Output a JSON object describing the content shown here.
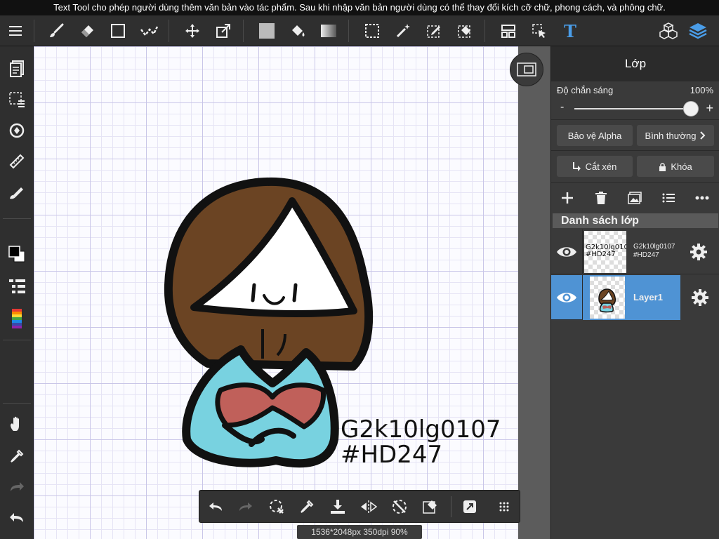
{
  "banner": {
    "text": "Text Tool cho phép người dùng thêm văn bản vào tác phẩm. Sau khi nhập văn bản người dùng có thể thay đổi kích cỡ chữ, phong cách, và phông chữ."
  },
  "toolbar": {
    "icons": [
      "menu-icon",
      "brush-icon",
      "eraser-icon",
      "rectangle-icon",
      "smudge-icon",
      "move-icon",
      "transform-icon",
      "fill-color-icon",
      "bucket-icon",
      "gradient-icon",
      "select-rect-icon",
      "magic-wand-icon",
      "select-pen-icon",
      "select-eraser-icon",
      "layout-icon",
      "select-move-icon",
      "text-tool-icon",
      "3d-model-icon",
      "layers-icon"
    ],
    "text_tool_glyph": "T"
  },
  "canvas": {
    "text_line1": "G2k10lg0107",
    "text_line2": "#HD247",
    "colors": {
      "hair": "#6b4423",
      "shirt": "#78d2e0",
      "bow": "#c0605a",
      "outline": "#111111"
    }
  },
  "status": {
    "canvas_info": "1536*2048px 350dpi 90%"
  },
  "panel": {
    "title": "Lớp",
    "opacity_label": "Độ chắn sáng",
    "opacity_value": "100%",
    "opacity_fraction": 1.0,
    "minus": "-",
    "plus": "+",
    "alpha_protect": "Bảo vệ Alpha",
    "blend_mode": "Bình thường",
    "clip": "Cắt xén",
    "lock": "Khóa",
    "list_header": "Danh sách lớp",
    "layers": [
      {
        "thumb_text": "G2k10lg0107\n#HD247",
        "name": "G2k10lg0107\n#HD247",
        "selected": false
      },
      {
        "name": "Layer1",
        "selected": true
      }
    ]
  }
}
